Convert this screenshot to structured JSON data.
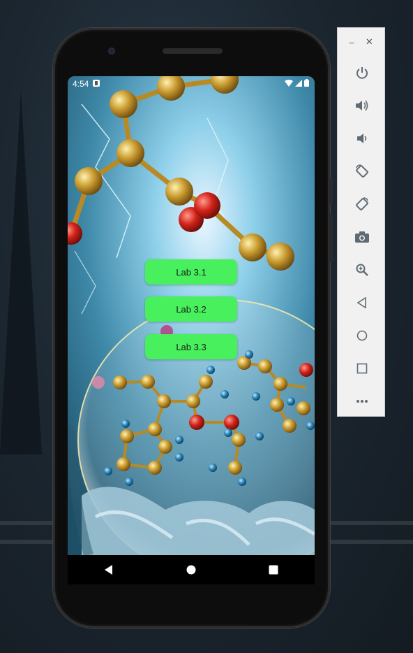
{
  "status_bar": {
    "time": "4:54",
    "left_icon": "notification-icon",
    "right_icons": [
      "wifi-icon",
      "signal-icon",
      "battery-icon"
    ]
  },
  "buttons": [
    {
      "label": "Lab 3.1"
    },
    {
      "label": "Lab 3.2"
    },
    {
      "label": "Lab 3.3"
    }
  ],
  "button_color": "#47f05c",
  "nav_bar": [
    "back-icon",
    "home-icon",
    "recents-icon"
  ],
  "emulator_toolbar": {
    "window_controls": [
      "minimize-icon",
      "close-icon"
    ],
    "items": [
      "power-icon",
      "volume-up-icon",
      "volume-down-icon",
      "rotate-left-icon",
      "rotate-right-icon",
      "camera-icon",
      "zoom-icon",
      "back-icon",
      "home-icon",
      "overview-icon",
      "more-icon"
    ]
  }
}
